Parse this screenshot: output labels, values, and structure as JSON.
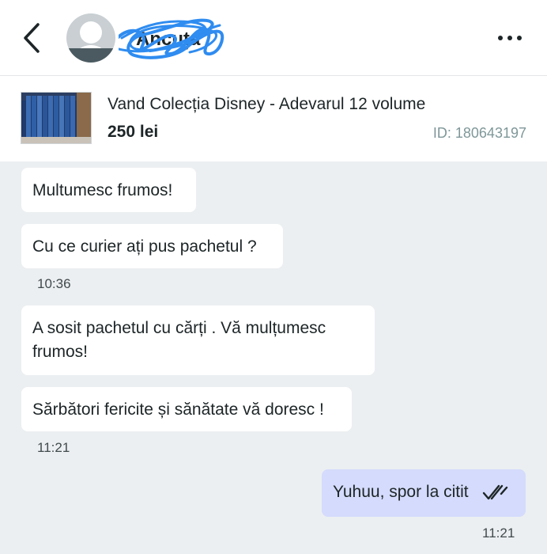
{
  "header": {
    "username": "Ancuța",
    "back_icon": "chevron-left-icon",
    "more_icon": "more-horizontal-icon"
  },
  "listing": {
    "title": "Vand Colecția Disney - Adevarul 12 volume",
    "price": "250 lei",
    "id_label": "ID: 180643197"
  },
  "messages": [
    {
      "direction": "in",
      "text": "Multumesc frumos!",
      "time": ""
    },
    {
      "direction": "in",
      "text": "Cu ce curier ați pus pachetul ?",
      "time": "10:36"
    },
    {
      "direction": "in",
      "text": "A sosit pachetul cu cărți . Vă mulțumesc frumos!",
      "time": ""
    },
    {
      "direction": "in",
      "text": "Sărbători fericite și sănătate vă doresc !",
      "time": "11:21"
    },
    {
      "direction": "out",
      "text": "Yuhuu, spor la citit",
      "time": "11:21",
      "status": "read"
    }
  ],
  "colors": {
    "background": "#eceff1",
    "incoming_bubble": "#ffffff",
    "outgoing_bubble": "#d4dbfc",
    "scribble": "#2f8cf0"
  }
}
